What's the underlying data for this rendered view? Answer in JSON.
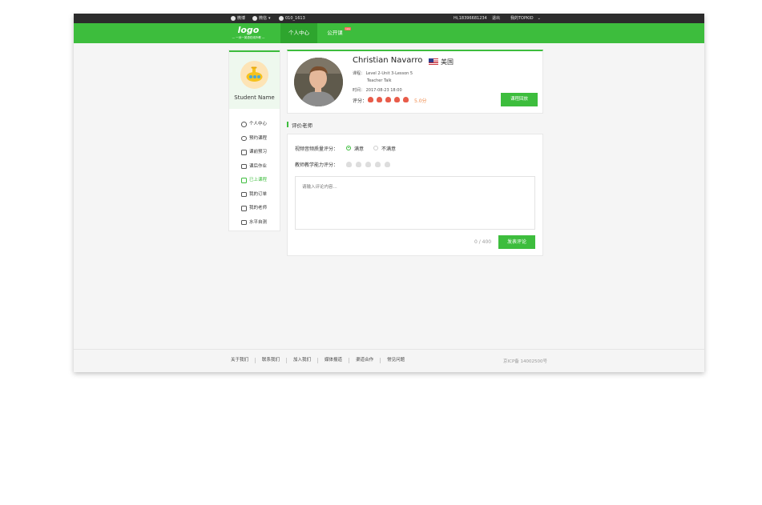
{
  "topbar": {
    "weibo": "微博",
    "weixin": "微信",
    "phone": "010_1613",
    "user": "Hi,18396681234",
    "logout": "退出",
    "my_account": "我的TOPKID"
  },
  "nav": {
    "logo_text": "logo",
    "logo_sub": "— 一对一英语在线外教 —",
    "tabs": [
      {
        "label": "个人中心",
        "active": true
      },
      {
        "label": "公开课",
        "active": false,
        "badge": "new"
      }
    ]
  },
  "sidebar": {
    "student_name": "Student Name",
    "items": [
      {
        "label": "个人中心",
        "icon": "user-icon"
      },
      {
        "label": "预约课程",
        "icon": "clock-icon"
      },
      {
        "label": "课前预习",
        "icon": "book-icon"
      },
      {
        "label": "课后作业",
        "icon": "edit-icon"
      },
      {
        "label": "已上课程",
        "icon": "flag-icon",
        "active": true
      },
      {
        "label": "我的订单",
        "icon": "clipboard-icon"
      },
      {
        "label": "我的老师",
        "icon": "teacher-icon"
      },
      {
        "label": "水平自测",
        "icon": "flask-icon"
      }
    ]
  },
  "teacher": {
    "name": "Christian Navarro",
    "country": "美国",
    "course_line": "课程：  Level 2-Unit 3-Lesson 5",
    "course_sub": "Teacher Talk",
    "time_line": "时间：  2017-08-23 18:00",
    "score_label": "评分：",
    "score_value": "5.0分",
    "score_count": 5,
    "review_button": "课程回放"
  },
  "evaluation": {
    "section_title": "评价老师",
    "video_quality_label": "视频音频质量评分：",
    "options": [
      "满意",
      "不满意"
    ],
    "selected": "满意",
    "teaching_label": "教师教学能力评分：",
    "placeholder": "请输入评论内容...",
    "char_count": "0 / 400",
    "submit": "发表评论"
  },
  "footer": {
    "links": [
      "关于我们",
      "联系我们",
      "加入我们",
      "媒体报道",
      "渠道合作",
      "常见问题"
    ],
    "icp": "京ICP备 14002500号"
  },
  "colors": {
    "brand_green": "#3dbd3d",
    "score_orange": "#f08a4b",
    "flower_red": "#e85c4a"
  }
}
